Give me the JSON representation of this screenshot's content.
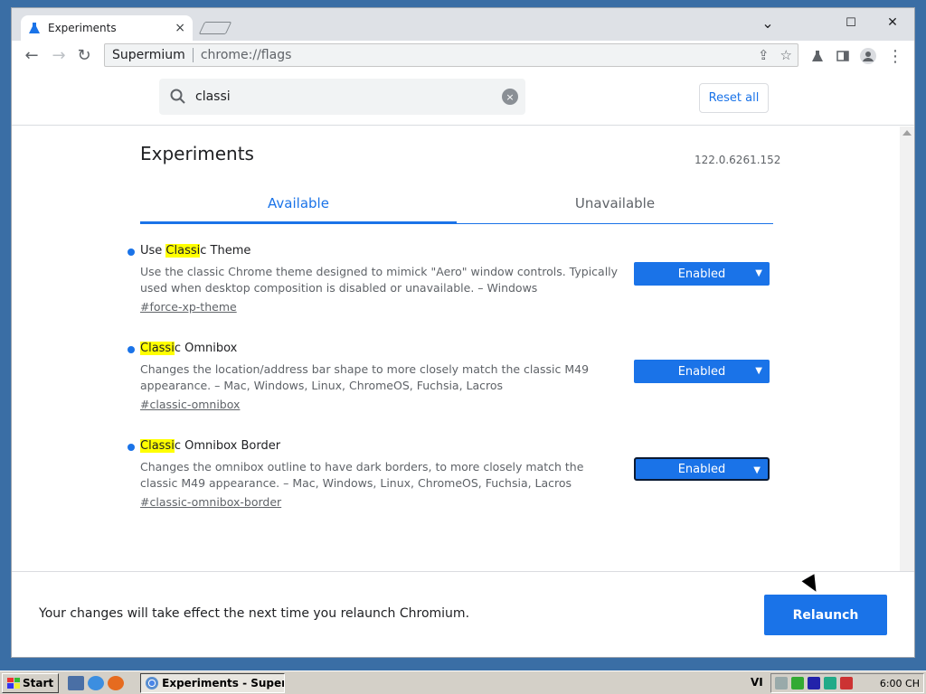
{
  "window": {
    "tab_title": "Experiments",
    "tab_close": "×",
    "minimize": "⌄",
    "maximize": "☐",
    "close": "✕"
  },
  "toolbar": {
    "back": "←",
    "forward": "→",
    "reload": "↻",
    "site_name": "Supermium",
    "url": "chrome://flags",
    "share": "⇪",
    "bookmark": "☆",
    "menu": "⋮"
  },
  "search": {
    "value": "classi",
    "clear": "×"
  },
  "reset_label": "Reset all",
  "page": {
    "title": "Experiments",
    "version": "122.0.6261.152",
    "tabs": [
      {
        "label": "Available"
      },
      {
        "label": "Unavailable"
      }
    ]
  },
  "flags": [
    {
      "title_pre": "Use ",
      "title_hl": "Classi",
      "title_post": "c Theme",
      "desc": "Use the classic Chrome theme designed to mimick \"Aero\" window controls. Typically used when desktop composition is disabled or unavailable. – Windows",
      "link": "#force-xp-theme",
      "value": "Enabled"
    },
    {
      "title_pre": "",
      "title_hl": "Classi",
      "title_post": "c Omnibox",
      "desc": "Changes the location/address bar shape to more closely match the classic M49 appearance. – Mac, Windows, Linux, ChromeOS, Fuchsia, Lacros",
      "link": "#classic-omnibox",
      "value": "Enabled"
    },
    {
      "title_pre": "",
      "title_hl": "Classi",
      "title_post": "c Omnibox Border",
      "desc": "Changes the omnibox outline to have dark borders, to more closely match the classic M49 appearance. – Mac, Windows, Linux, ChromeOS, Fuchsia, Lacros",
      "link": "#classic-omnibox-border",
      "value": "Enabled"
    }
  ],
  "footer": {
    "message": "Your changes will take effect the next time you relaunch Chromium.",
    "relaunch": "Relaunch"
  },
  "taskbar": {
    "start": "Start",
    "task": "Experiments - Super...",
    "lang": "VI",
    "clock": "6:00 CH"
  },
  "colors": {
    "accent": "#1a73e8",
    "highlight": "#ffff00",
    "desktop": "#3a6ea5"
  }
}
